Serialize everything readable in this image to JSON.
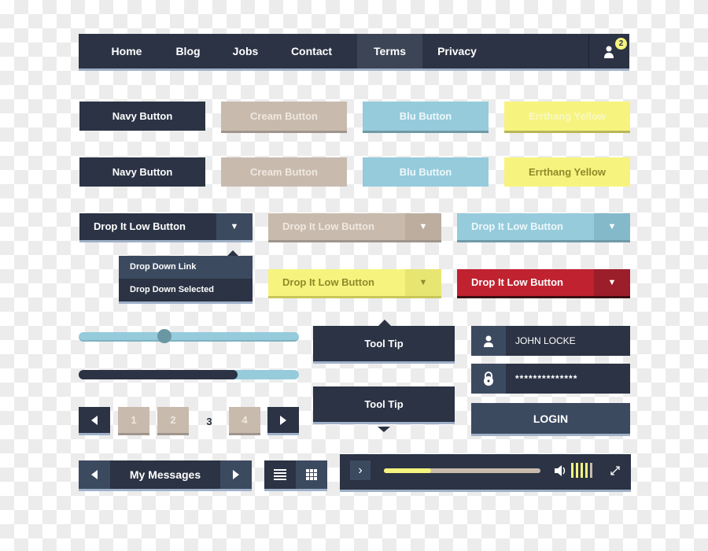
{
  "nav": {
    "items": [
      "Home",
      "Blog",
      "Jobs",
      "Contact",
      "Terms",
      "Privacy"
    ],
    "active": "Terms",
    "badge": "2"
  },
  "buttons": {
    "navy": "Navy Button",
    "cream": "Cream Button",
    "blu": "Blu Button",
    "yellow": "Errthang Yellow"
  },
  "dropdowns": {
    "label": "Drop It Low Button",
    "menu": [
      "Drop Down Link",
      "Drop Down Selected"
    ]
  },
  "slider": {
    "value_percent": 39
  },
  "progress": {
    "value_percent": 72
  },
  "pagination": {
    "pages": [
      "1",
      "2",
      "3",
      "4"
    ],
    "current": "3"
  },
  "tooltips": [
    "Tool Tip",
    "Tool Tip"
  ],
  "login": {
    "username": "JOHN LOCKE",
    "password": "**************",
    "button": "LOGIN"
  },
  "messages": {
    "label": "My Messages"
  },
  "player": {
    "progress_percent": 30,
    "volume_bars": 4,
    "volume_total": 5
  },
  "colors": {
    "navy": "#2b3344",
    "cream": "#c8baad",
    "blu": "#95cbdb",
    "yellow": "#f6f47e",
    "red": "#c0222f"
  }
}
